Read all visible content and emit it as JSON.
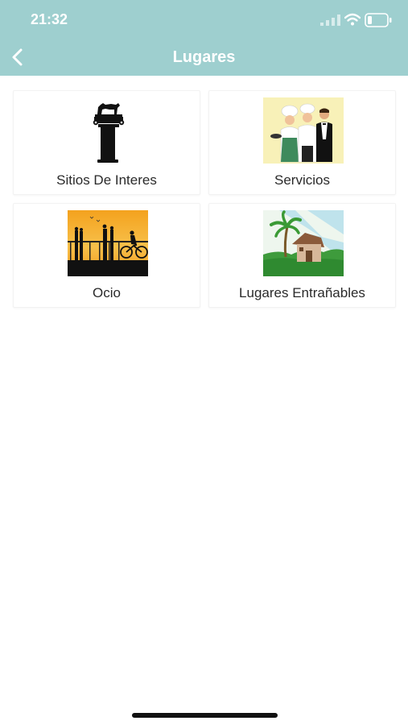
{
  "status_bar": {
    "time": "21:32",
    "signal_icon": "cellular-signal-icon",
    "wifi_icon": "wifi-icon",
    "battery_icon": "battery-low-icon"
  },
  "header": {
    "title": "Lugares",
    "back_icon": "chevron-left-icon",
    "background_color": "#9ecfcf"
  },
  "categories": [
    {
      "label": "Sitios De Interes",
      "icon": "column-with-wolf-statue-icon"
    },
    {
      "label": "Servicios",
      "icon": "chefs-and-waiter-icon"
    },
    {
      "label": "Ocio",
      "icon": "sunset-silhouettes-icon"
    },
    {
      "label": "Lugares Entrañables",
      "icon": "house-with-palm-tree-icon"
    }
  ]
}
